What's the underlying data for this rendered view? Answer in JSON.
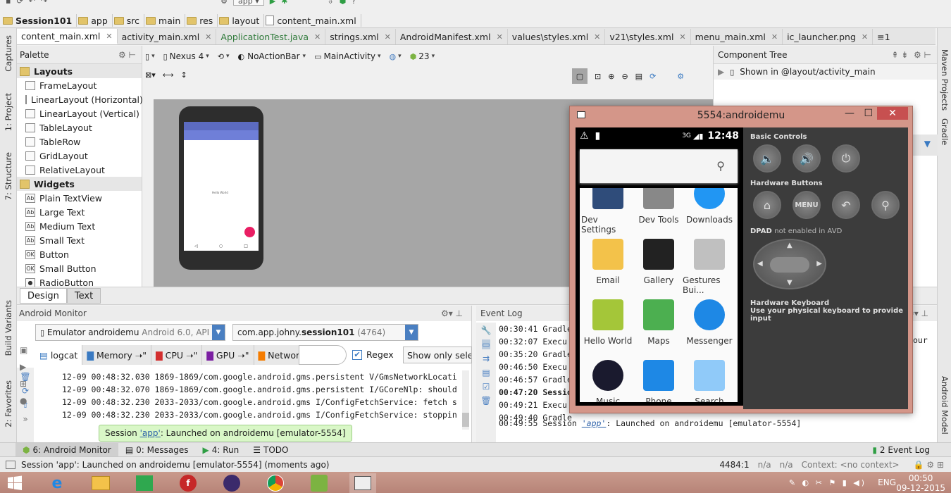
{
  "breadcrumb": {
    "items": [
      "Session101",
      "app",
      "src",
      "main",
      "res",
      "layout",
      "content_main.xml"
    ]
  },
  "run_config": "app",
  "file_tabs": [
    "content_main.xml",
    "activity_main.xml",
    "ApplicationTest.java",
    "strings.xml",
    "AndroidManifest.xml",
    "values\\styles.xml",
    "v21\\styles.xml",
    "menu_main.xml",
    "ic_launcher.png"
  ],
  "tabs_overflow": "≡1",
  "left_strip": {
    "captures": "Captures",
    "project": "1: Project",
    "structure": "7: Structure",
    "build_variants": "Build Variants",
    "favorites": "2: Favorites"
  },
  "right_strip": {
    "maven": "Maven Projects",
    "gradle": "Gradle",
    "android_model": "Android Model"
  },
  "palette": {
    "title": "Palette",
    "items": [
      {
        "label": "Layouts",
        "group": true
      },
      {
        "label": "FrameLayout"
      },
      {
        "label": "LinearLayout (Horizontal)"
      },
      {
        "label": "LinearLayout (Vertical)"
      },
      {
        "label": "TableLayout"
      },
      {
        "label": "TableRow"
      },
      {
        "label": "GridLayout"
      },
      {
        "label": "RelativeLayout"
      },
      {
        "label": "Widgets",
        "group": true
      },
      {
        "label": "Plain TextView",
        "badge": "Ab"
      },
      {
        "label": "Large Text",
        "badge": "Ab"
      },
      {
        "label": "Medium Text",
        "badge": "Ab"
      },
      {
        "label": "Small Text",
        "badge": "Ab"
      },
      {
        "label": "Button",
        "badge": "OK"
      },
      {
        "label": "Small Button",
        "badge": "OK"
      },
      {
        "label": "RadioButton",
        "badge": "●"
      }
    ]
  },
  "designer_toolbar": {
    "device": "Nexus 4",
    "theme": "NoActionBar",
    "activity": "MainActivity",
    "api": "23"
  },
  "phone_preview": {
    "text": "Hello World"
  },
  "component_tree": {
    "title": "Component Tree",
    "shown_in": "Shown in @layout/activity_main"
  },
  "design_tabs": [
    "Design",
    "Text"
  ],
  "android_monitor": {
    "title": "Android Monitor",
    "device_name": "Emulator androidemu",
    "device_api": "Android 6.0, API 23",
    "process": "com.app.johny.session101",
    "process_pid": "(4764)",
    "tabs": [
      "logcat",
      "Memory",
      "CPU",
      "GPU",
      "Network"
    ],
    "regex_label": "Regex",
    "regex_checked": true,
    "filter_label": "Show only select",
    "logs": [
      "12-09 00:48:32.030 1869-1869/com.google.android.gms.persistent V/GmsNetworkLocati",
      "12-09 00:48:32.070 1869-1869/com.google.android.gms.persistent I/GCoreNlp: should",
      "12-09 00:48:32.230 2033-2033/com.google.android.gms I/ConfigFetchService: fetch s",
      "12-09 00:48:32.230 2033-2033/com.google.android.gms I/ConfigFetchService: stoppin"
    ]
  },
  "event_log": {
    "title": "Event Log",
    "entries": [
      {
        "time": "00:30:41",
        "text": "Gradle"
      },
      {
        "time": "00:32:07",
        "text": "Execu"
      },
      {
        "time": "00:35:20",
        "text": "Gradle"
      },
      {
        "time": "00:46:50",
        "text": "Execu"
      },
      {
        "time": "00:46:57",
        "text": "Gradle"
      },
      {
        "time": "00:47:20",
        "text": "Sessio"
      },
      {
        "time": "00:49:21",
        "text": "Execu"
      },
      {
        "time": "00:49:40",
        "text": "Gradle"
      }
    ],
    "last": {
      "time": "00:49:55",
      "prefix": "Session",
      "link": "'app'",
      "suffix": ": Launched on androidemu [emulator-5554]"
    },
    "overflow_text": "our"
  },
  "balloon": {
    "prefix": "Session",
    "link": "'app'",
    "suffix": ": Launched on androidemu [emulator-5554]"
  },
  "bottom_tabs": [
    {
      "label": "6: Android Monitor"
    },
    {
      "label": "0: Messages"
    },
    {
      "label": "4: Run"
    },
    {
      "label": "TODO"
    }
  ],
  "event_log_tab": "2 Event Log",
  "status": {
    "message": "Session 'app': Launched on androidemu [emulator-5554] (moments ago)",
    "position": "4484:1",
    "na1": "n/a",
    "na2": "n/a",
    "context": "Context: <no context>"
  },
  "emulator": {
    "title": "5554:androidemu",
    "time": "12:48",
    "signal": "3G",
    "apps": [
      {
        "label": "Dev Settings",
        "color": "#2f4c7a"
      },
      {
        "label": "Dev Tools",
        "color": "#888"
      },
      {
        "label": "Downloads",
        "color": "#2196f3"
      },
      {
        "label": "Email",
        "color": "#f3c24a"
      },
      {
        "label": "Gallery",
        "color": "#222"
      },
      {
        "label": "Gestures Bui...",
        "color": "#c0c0c0"
      },
      {
        "label": "Hello World",
        "color": "#a4c639"
      },
      {
        "label": "Maps",
        "color": "#4caf50"
      },
      {
        "label": "Messenger",
        "color": "#1e88e5"
      },
      {
        "label": "Music",
        "color": "#1a1a2e"
      },
      {
        "label": "Phone",
        "color": "#1e88e5"
      },
      {
        "label": "Search",
        "color": "#90caf9"
      }
    ],
    "panel": {
      "basic_controls": "Basic Controls",
      "hardware_buttons": "Hardware Buttons",
      "menu_label": "MENU",
      "dpad_title": "DPAD",
      "dpad_note": "not enabled in AVD",
      "keyboard_title": "Hardware Keyboard",
      "keyboard_note": "Use your physical keyboard to provide input"
    }
  },
  "taskbar": {
    "lang": "ENG",
    "time": "00:50",
    "date": "09-12-2015"
  }
}
